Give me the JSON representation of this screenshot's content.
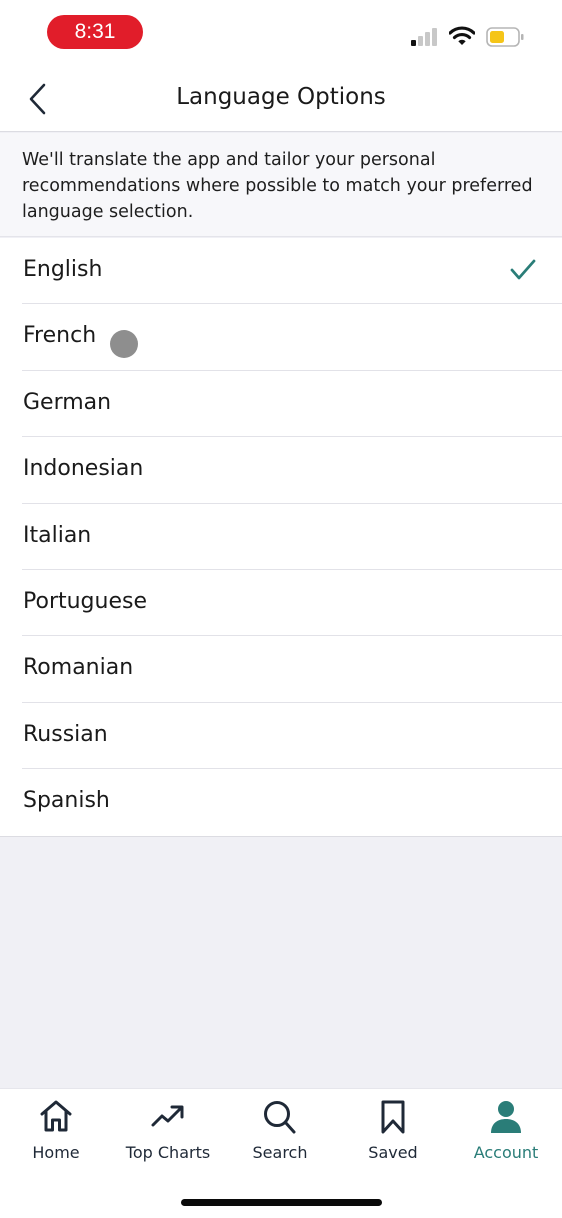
{
  "status_bar": {
    "time": "8:31",
    "icons": [
      "cellular-signal-icon",
      "wifi-icon",
      "battery-icon"
    ],
    "time_pill_color": "#e11d2a",
    "battery_color": "#f5c518"
  },
  "nav": {
    "title": "Language Options",
    "back_icon": "chevron-left-icon"
  },
  "info": {
    "text": "We'll translate the app and tailor your personal recommendations where possible to match your preferred language selection."
  },
  "languages": {
    "items": [
      {
        "label": "English",
        "selected": true
      },
      {
        "label": "French",
        "selected": false
      },
      {
        "label": "German",
        "selected": false
      },
      {
        "label": "Indonesian",
        "selected": false
      },
      {
        "label": "Italian",
        "selected": false
      },
      {
        "label": "Portuguese",
        "selected": false
      },
      {
        "label": "Romanian",
        "selected": false
      },
      {
        "label": "Russian",
        "selected": false
      },
      {
        "label": "Spanish",
        "selected": false
      }
    ],
    "selected_icon": "checkmark-icon",
    "accent_color": "#2a7d78"
  },
  "tab_bar": {
    "tabs": [
      {
        "label": "Home",
        "icon": "home-icon",
        "active": false
      },
      {
        "label": "Top Charts",
        "icon": "trending-up-icon",
        "active": false
      },
      {
        "label": "Search",
        "icon": "search-icon",
        "active": false
      },
      {
        "label": "Saved",
        "icon": "bookmark-icon",
        "active": false
      },
      {
        "label": "Account",
        "icon": "person-icon",
        "active": true
      }
    ],
    "active_color": "#2a7d78"
  }
}
